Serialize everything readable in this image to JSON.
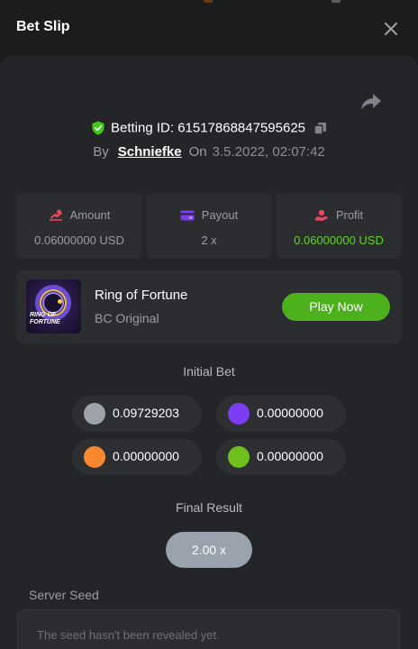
{
  "header": {
    "title": "Bet Slip"
  },
  "bet": {
    "betting_id_label": "Betting ID:",
    "betting_id": "61517868847595625",
    "by_label": "By",
    "username": "Schniefke",
    "on_label": "On",
    "date": "3.5.2022, 02:07:42"
  },
  "stats": [
    {
      "label": "Amount",
      "value": "0.06000000 USD",
      "icon": "amount-icon"
    },
    {
      "label": "Payout",
      "value": "2 x",
      "icon": "payout-icon"
    },
    {
      "label": "Profit",
      "value": "0.06000000 USD",
      "icon": "profit-icon"
    }
  ],
  "game": {
    "name": "Ring of Fortune",
    "subtitle": "BC Original",
    "play_label": "Play Now",
    "thumb_text_1": "RING OF",
    "thumb_text_2": "FORTUNE"
  },
  "initial_bet": {
    "title": "Initial Bet",
    "coins": [
      {
        "value": "0.09729203",
        "color": "#9da3ab"
      },
      {
        "value": "0.00000000",
        "color": "#7b3cf2"
      },
      {
        "value": "0.00000000",
        "color": "#f7882f"
      },
      {
        "value": "0.00000000",
        "color": "#6fc01c"
      }
    ]
  },
  "final_result": {
    "title": "Final Result",
    "value": "2.00 x"
  },
  "server_seed": {
    "label": "Server Seed",
    "placeholder": "The seed hasn't been revealed yet."
  },
  "colors": {
    "accent_green": "#5fd61d",
    "button_green": "#4cb11c",
    "background": "#1b1c1e",
    "panel": "#232528"
  }
}
